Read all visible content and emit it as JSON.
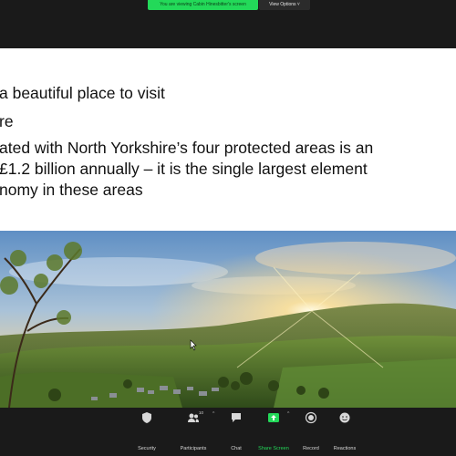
{
  "share_banner": "You are viewing Cabin Hinesbitter's screen",
  "view_options": "View Options ˅",
  "slide": {
    "bullets": [
      "a beautiful place to visit",
      "re",
      "ated with North Yorkshire’s four protected areas is an",
      "£1.2 billion annually – it is the single largest element",
      "nomy in these areas"
    ]
  },
  "toolbar": {
    "items": [
      "Security",
      "Participants",
      "Chat",
      "Share Screen",
      "Record",
      "Reactions"
    ],
    "participants_count": "10",
    "caret": "^",
    "share_color": "#23d959"
  }
}
